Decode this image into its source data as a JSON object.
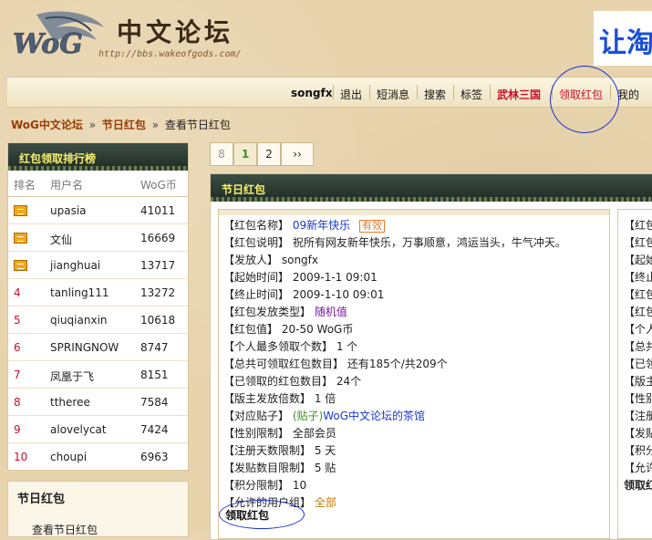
{
  "header": {
    "logo_mark": "WoG",
    "title": "中文论坛",
    "url": "http://bbs.wakeofgods.com/",
    "banner_text": "让淘"
  },
  "nav": {
    "user": "songfx",
    "items": [
      "退出",
      "短消息",
      "搜索",
      "标签",
      "武林三国",
      "领取红包",
      "我的"
    ]
  },
  "breadcrumb": {
    "items": [
      "WoG中文论坛",
      "节日红包",
      "查看节日红包"
    ],
    "separator": "»"
  },
  "rank_panel": {
    "title": "红包领取排行榜",
    "headers": [
      "排名",
      "用户名",
      "WoG币"
    ],
    "rows": [
      {
        "rank": "1",
        "name": "upasia",
        "coin": "41011"
      },
      {
        "rank": "2",
        "name": "文仙",
        "coin": "16669"
      },
      {
        "rank": "3",
        "name": "jianghuai",
        "coin": "13717"
      },
      {
        "rank": "4",
        "name": "tanling111",
        "coin": "13272"
      },
      {
        "rank": "5",
        "name": "qiuqianxin",
        "coin": "10618"
      },
      {
        "rank": "6",
        "name": "SPRINGNOW",
        "coin": "8747"
      },
      {
        "rank": "7",
        "name": "凤凰于飞",
        "coin": "8151"
      },
      {
        "rank": "8",
        "name": "ttheree",
        "coin": "7584"
      },
      {
        "rank": "9",
        "name": "alovelycat",
        "coin": "7424"
      },
      {
        "rank": "10",
        "name": "choupi",
        "coin": "6963"
      }
    ]
  },
  "holiday_box": {
    "title": "节日红包",
    "item": "查看节日红包"
  },
  "pager": {
    "total": "8",
    "current": "1",
    "next": "2",
    "last": "››"
  },
  "main_panel": {
    "title": "节日红包",
    "fields": {
      "name_label": "【红包名称】",
      "name_value": "09新年快乐",
      "status_badge": "有效",
      "desc_label": "【红包说明】",
      "desc_value": "祝所有网友新年快乐，万事顺意，鸿运当头，牛气冲天。",
      "sender_label": "【发放人】",
      "sender_value": "songfx",
      "start_label": "【起始时间】",
      "start_value": "2009-1-1 09:01",
      "end_label": "【终止时间】",
      "end_value": "2009-1-10 09:01",
      "type_label": "【红包发放类型】",
      "type_value": "随机值",
      "amount_label": "【红包值】",
      "amount_value": "20-50  WoG币",
      "per_user_label": "【个人最多领取个数】",
      "per_user_value": "1 个",
      "total_label": "【总共可领取红包数目】",
      "total_value": "还有185个/共209个",
      "claimed_label": "【已领取的红包数目】",
      "claimed_value": "24个",
      "multiplier_label": "【版主发放倍数】",
      "multiplier_value": "1 倍",
      "thread_label": "【对应贴子】",
      "thread_tag": "(贴子)",
      "thread_value": "WoG中文论坛的茶馆",
      "gender_label": "【性别限制】",
      "gender_value": "全部会员",
      "regdays_label": "【注册天数限制】",
      "regdays_value": "5 天",
      "posts_label": "【发贴数目限制】",
      "posts_value": "5 贴",
      "credits_label": "【积分限制】",
      "credits_value": "10",
      "groups_label": "【允许的用户组】",
      "groups_value": "全部"
    },
    "claim_link": "领取红包"
  },
  "right_clip": {
    "lines": [
      "【红包",
      "【红包",
      "【起始",
      "【终止",
      "【红包",
      "【红包",
      "【个人",
      "【总共",
      "【已领",
      "【版主",
      "【性别",
      "【注册",
      "【发贴",
      "【积分",
      "【允许",
      "领取红"
    ]
  },
  "colors": {
    "link_blue": "#1a3ad6",
    "nav_red": "#c8102e",
    "panel_dark": "#1f2a24",
    "panel_title_yellow": "#f8f070",
    "annotation_circle": "#1b2fd3"
  }
}
